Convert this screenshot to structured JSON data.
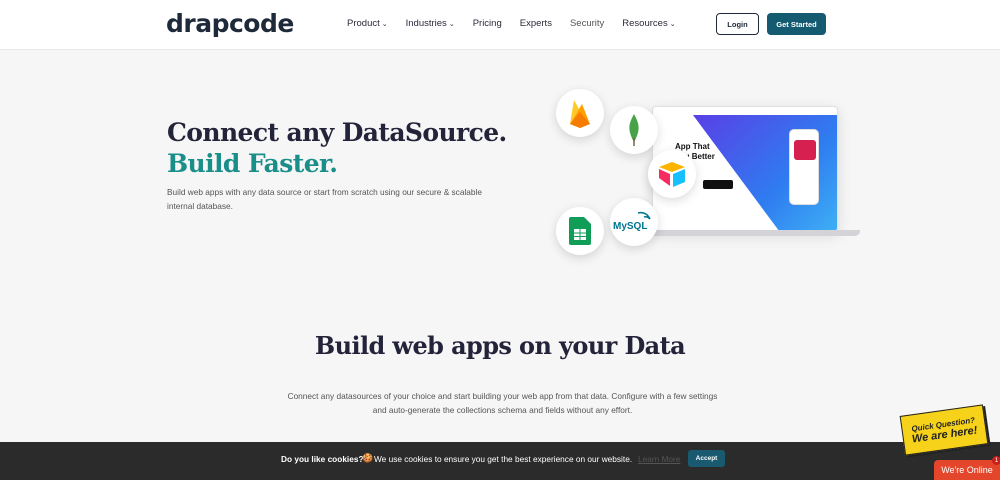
{
  "nav": {
    "logo": "drapcode",
    "menu": [
      {
        "label": "Product",
        "has_dropdown": true
      },
      {
        "label": "Industries",
        "has_dropdown": true
      },
      {
        "label": "Pricing",
        "has_dropdown": false
      },
      {
        "label": "Experts",
        "has_dropdown": false
      },
      {
        "label": "Security",
        "has_dropdown": false
      },
      {
        "label": "Resources",
        "has_dropdown": true
      }
    ],
    "dropdown_glyph": "⌄",
    "login_label": "Login",
    "get_started_label": "Get Started"
  },
  "hero": {
    "title": "Connect any DataSource.",
    "subtitle": "Build Faster.",
    "description": "Build web apps with any data source or start from scratch using our secure & scalable internal database.",
    "mockup_text": "App That\nYou Better",
    "datasources": [
      "firebase-icon",
      "mongodb-icon",
      "airtable-icon",
      "google-sheets-icon",
      "mysql-icon"
    ],
    "mysql_label": "MySQL"
  },
  "section": {
    "title": "Build web apps on your Data",
    "description": "Connect any datasources of your choice and start building your web app from that data. Configure with a few settings and auto-generate the collections schema and fields without any effort."
  },
  "cookie": {
    "question": "Do you like cookies?",
    "icon": "🍪",
    "message": "We use cookies to ensure you get the best experience on our website.",
    "learn_more": "Learn More",
    "accept_label": "Accept"
  },
  "chat": {
    "quick_question": "Quick Question?",
    "we_are_here": "We are here!",
    "online_label": "We're Online",
    "badge_count": "1"
  },
  "colors": {
    "brand_dark": "#1e2a3a",
    "teal": "#1a8f8a",
    "cta": "#145a70",
    "cookie_bg": "#2b2b2b"
  }
}
